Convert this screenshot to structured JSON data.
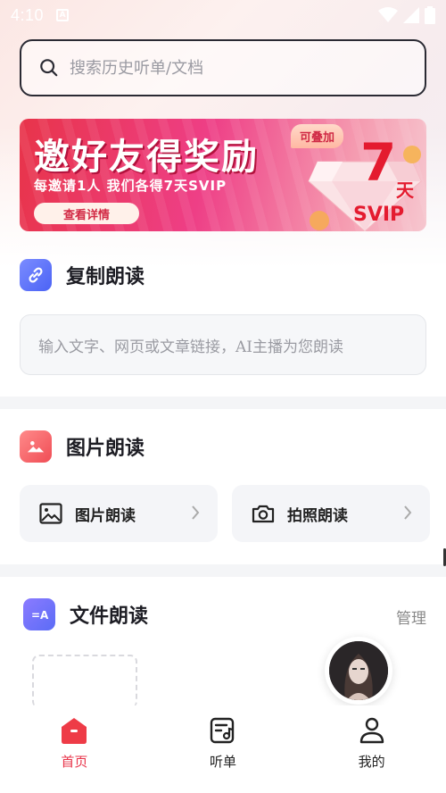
{
  "status_bar": {
    "time": "4:10",
    "notification_icon": "A"
  },
  "search": {
    "placeholder": "搜索历史听单/文档"
  },
  "banner": {
    "title": "邀好友得奖励",
    "subtitle": "每邀请1人 我们各得7天SVIP",
    "button_label": "查看详情",
    "tag": "可叠加",
    "big_number": "7",
    "unit": "天",
    "badge": "SVIP",
    "colors": {
      "start": "#e8344a",
      "mid": "#ee3f86",
      "accent": "#e41b2f"
    }
  },
  "copy_read": {
    "title": "复制朗读",
    "placeholder": "输入文字、网页或文章链接，AI主播为您朗读"
  },
  "image_read": {
    "title": "图片朗读",
    "buttons": [
      {
        "label": "图片朗读",
        "icon": "image-icon"
      },
      {
        "label": "拍照朗读",
        "icon": "camera-icon"
      }
    ]
  },
  "file_read": {
    "title": "文件朗读",
    "manage_label": "管理"
  },
  "tabbar": {
    "items": [
      {
        "label": "首页",
        "icon": "home-icon",
        "active": true
      },
      {
        "label": "听单",
        "icon": "playlist-icon",
        "active": false
      },
      {
        "label": "我的",
        "icon": "profile-icon",
        "active": false
      }
    ],
    "active_color": "#e8344a"
  }
}
